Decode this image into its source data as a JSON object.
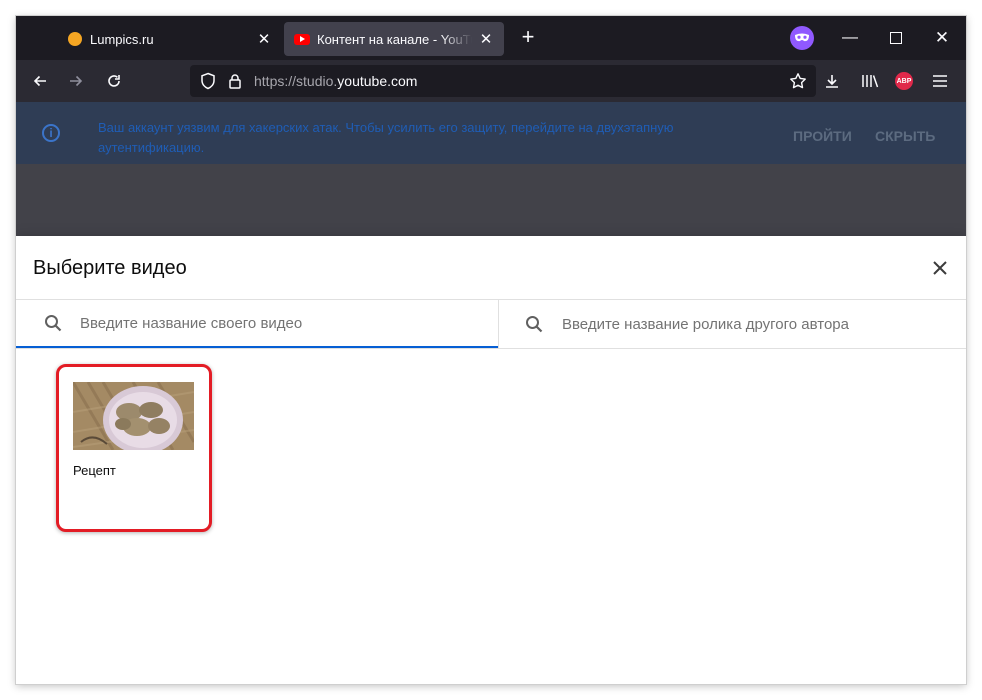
{
  "browser": {
    "tabs": [
      {
        "title": "Lumpics.ru",
        "favicon": "lumpics-favicon",
        "active": false
      },
      {
        "title": "Контент на канале - YouTube Studio",
        "favicon": "youtube-favicon",
        "active": true
      }
    ],
    "url": {
      "prefix": "https://studio.",
      "host": "youtube.com"
    },
    "extension_abp_label": "ABP"
  },
  "banner": {
    "text": "Ваш аккаунт уязвим для хакерских атак. Чтобы усилить его защиту, перейдите на двухэтапную аутентификацию.",
    "go_label": "ПРОЙТИ",
    "hide_label": "СКРЫТЬ"
  },
  "modal": {
    "title": "Выберите видео",
    "search_own_placeholder": "Введите название своего видео",
    "search_other_placeholder": "Введите название ролика другого автора",
    "videos": [
      {
        "title": "Рецепт",
        "highlighted": true
      }
    ]
  },
  "colors": {
    "tab_bar": "#1c1b22",
    "nav_bar": "#2b2a33",
    "active_search_underline": "#065fd4",
    "highlight_border": "#e31c25",
    "banner_text": "#1f5db5"
  }
}
